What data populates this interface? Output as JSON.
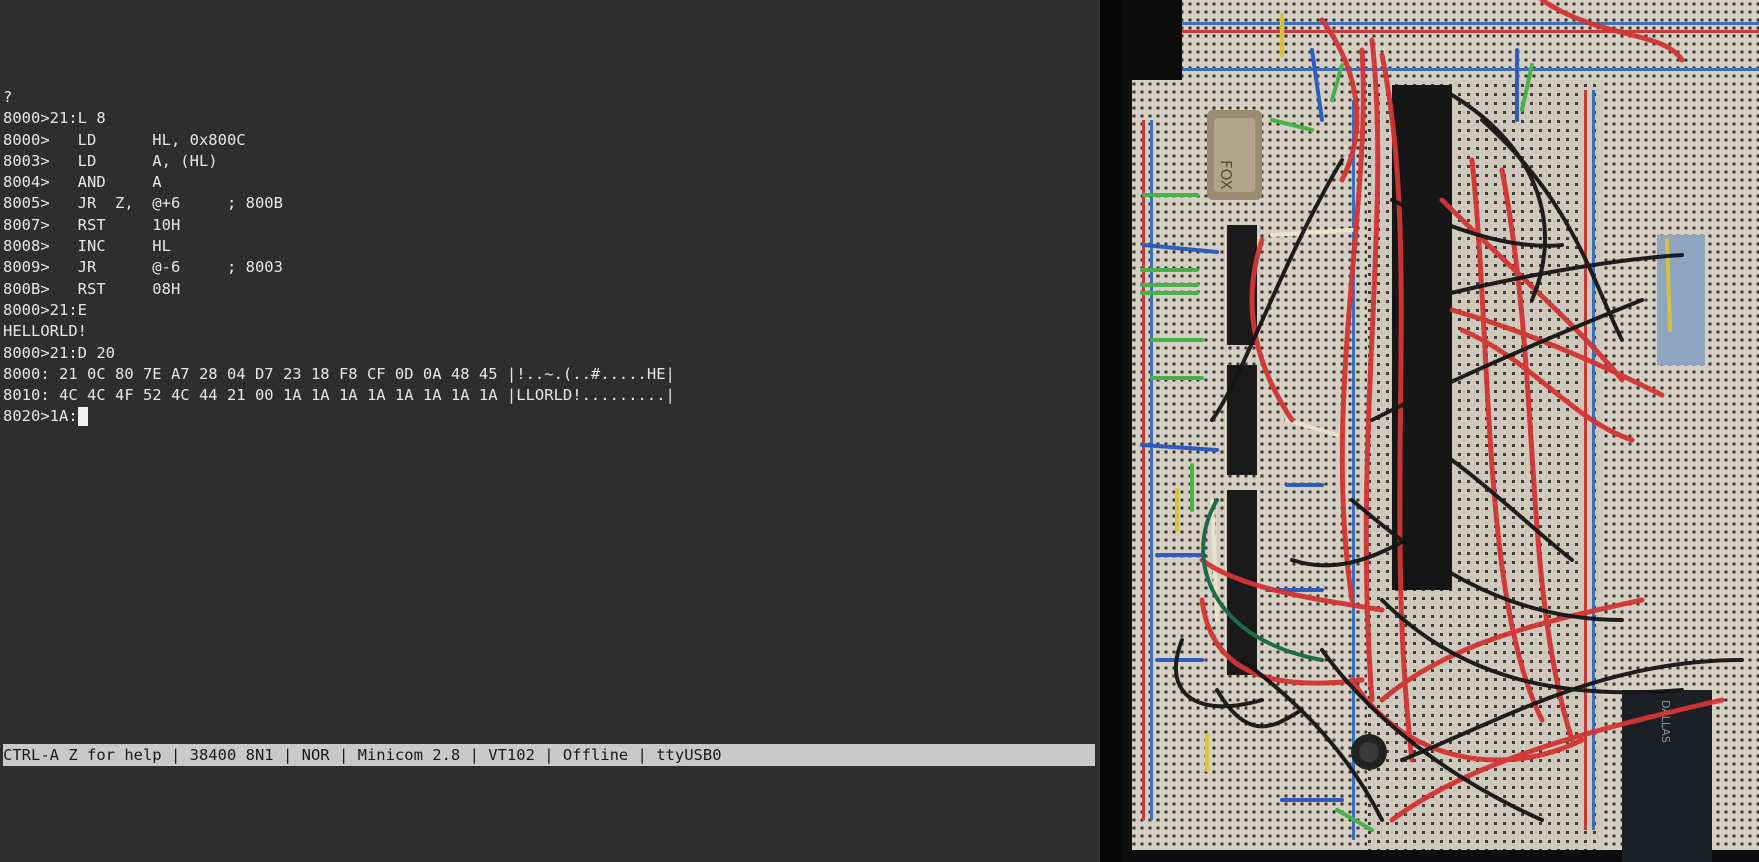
{
  "terminal": {
    "lines": [
      "?",
      "8000>21:L 8",
      "8000>   LD      HL, 0x800C",
      "8003>   LD      A, (HL)",
      "8004>   AND     A",
      "8005>   JR  Z,  @+6     ; 800B",
      "8007>   RST     10H",
      "8008>   INC     HL",
      "8009>   JR      @-6     ; 8003",
      "800B>   RST     08H",
      "8000>21:E",
      "HELLORLD!",
      "8000>21:D 20",
      "8000: 21 0C 80 7E A7 28 04 D7 23 18 F8 CF 0D 0A 48 45 |!..~.(..#.....HE|",
      "8010: 4C 4C 4F 52 4C 44 21 00 1A 1A 1A 1A 1A 1A 1A 1A |LLORLD!.........|"
    ],
    "prompt": "8020>1A:",
    "status_bar": "CTRL-A Z for help | 38400 8N1 | NOR | Minicom 2.8 | VT102 | Offline | ttyUSB0"
  },
  "photo": {
    "crystal_label": "FOX",
    "chip_label": "DALLAS"
  }
}
